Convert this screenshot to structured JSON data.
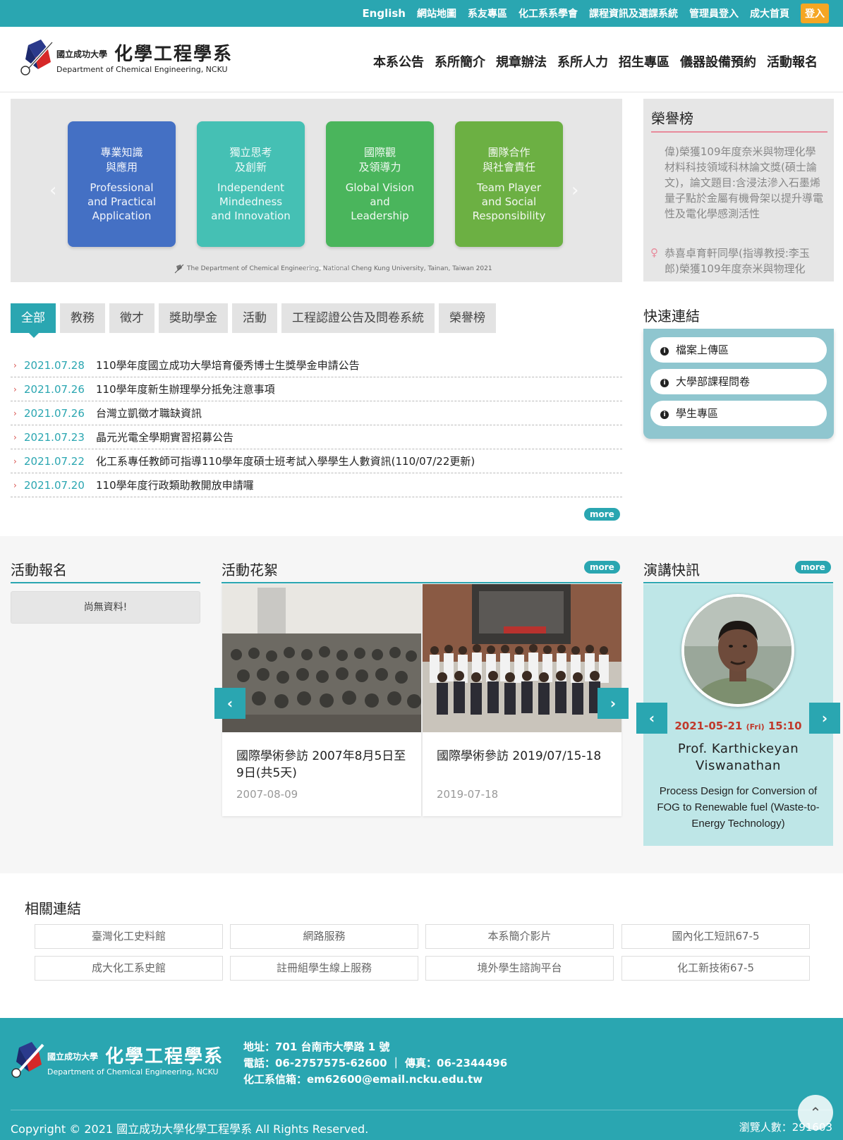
{
  "topbar": {
    "links": [
      "English",
      "網站地圖",
      "系友專區",
      "化工系系學會",
      "課程資訊及選課系統",
      "管理員登入",
      "成大首頁"
    ],
    "login": "登入"
  },
  "logo": {
    "university": "國立成功大學",
    "dept_zh": "化學工程學系",
    "dept_en": "Department of Chemical Engineering, NCKU"
  },
  "mainnav": [
    "本系公告",
    "系所簡介",
    "規章辦法",
    "系所人力",
    "招生專區",
    "儀器設備預約",
    "活動報名"
  ],
  "banner": {
    "cards": [
      {
        "zh": "專業知識\n與應用",
        "en": "Professional\nand Practical\nApplication",
        "color": "#4470c4"
      },
      {
        "zh": "獨立思考\n及創新",
        "en": "Independent\nMindedness\nand Innovation",
        "color": "#45c0b4"
      },
      {
        "zh": "國際觀\n及領導力",
        "en": "Global Vision\nand\nLeadership",
        "color": "#4ab55c"
      },
      {
        "zh": "團隊合作\n與社會責任",
        "en": "Team Player\nand Social\nResponsibility",
        "color": "#6cb043"
      }
    ],
    "caption": "The Department of Chemical Engineering, National Cheng Kung University, Tainan, Taiwan 2021"
  },
  "honor": {
    "title": "榮譽榜",
    "items": [
      "偉)榮獲109年度奈米與物理化學材料科技領域科林論文獎(碩士論文)，論文題目:含浸法滲入石墨烯量子點於金屬有機骨架以提升導電性及電化學感測活性",
      "恭喜卓育軒同學(指導教授:李玉郎)榮獲109年度奈米與物理化"
    ]
  },
  "tabs": [
    "全部",
    "教務",
    "徵才",
    "獎助學金",
    "活動",
    "工程認證公告及問卷系統",
    "榮譽榜"
  ],
  "news": [
    {
      "date": "2021.07.28",
      "title": "110學年度國立成功大學培育優秀博士生獎學金申請公告"
    },
    {
      "date": "2021.07.26",
      "title": "110學年度新生辦理學分抵免注意事項"
    },
    {
      "date": "2021.07.26",
      "title": "台灣立凱徵才職缺資訊"
    },
    {
      "date": "2021.07.23",
      "title": "晶元光電全學期實習招募公告"
    },
    {
      "date": "2021.07.22",
      "title": "化工系專任教師可指導110學年度碩士班考試入學學生人數資訊(110/07/22更新)"
    },
    {
      "date": "2021.07.20",
      "title": "110學年度行政類助教開放申請囉"
    }
  ],
  "more": "more",
  "quick": {
    "title": "快速連結",
    "items": [
      "檔案上傳區",
      "大學部課程問卷",
      "學生專區"
    ]
  },
  "events": {
    "title": "活動報名",
    "empty": "尚無資料!"
  },
  "gallery": {
    "title": "活動花絮",
    "items": [
      {
        "title": "國際學術參訪 2007年8月5日至9日(共5天)",
        "date": "2007-08-09"
      },
      {
        "title": "國際學術參訪 2019/07/15-18",
        "date": "2019-07-18"
      }
    ]
  },
  "speech": {
    "title": "演講快訊",
    "date": "2021-05-21",
    "weekday": "(Fri)",
    "time": "15:10",
    "name": "Prof. Karthickeyan Viswanathan",
    "topic": "Process Design for Conversion of FOG to Renewable fuel (Waste-to-Energy Technology)"
  },
  "related": {
    "title": "相關連結",
    "links": [
      "臺灣化工史料館",
      "網路服務",
      "本系簡介影片",
      "國內化工短訊67-5",
      "成大化工系史館",
      "註冊組學生線上服務",
      "境外學生諮詢平台",
      "化工新技術67-5"
    ]
  },
  "footer": {
    "address": "地址：701 台南市大學路 1 號",
    "phone": "電話：06-2757575-62600 ｜ 傳真：06-2344496",
    "email": "化工系信箱：em62600@email.ncku.edu.tw",
    "copyright": "Copyright © 2021 國立成功大學化學工程學系 All Rights Reserved.",
    "visits": "瀏覽人數：291603"
  },
  "colors": {
    "accent": "#2aa6b1",
    "login": "#f5a623",
    "honor_accent": "#e88a9b",
    "speech_date": "#c0392b"
  }
}
